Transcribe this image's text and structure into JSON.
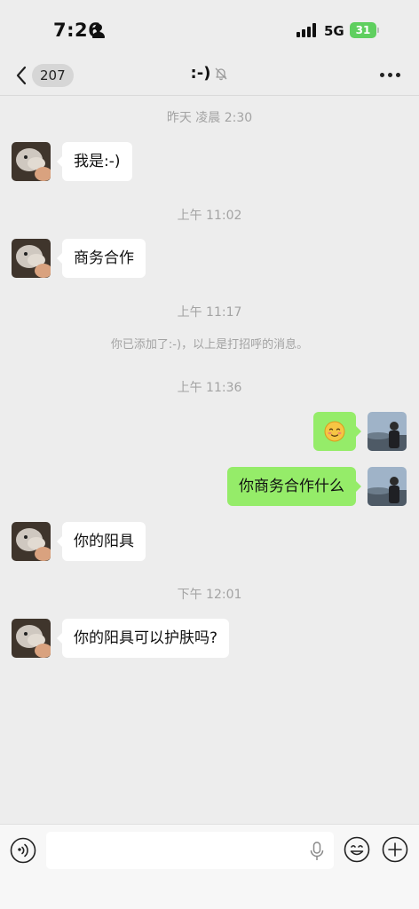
{
  "status_bar": {
    "time": "7:26",
    "network": "5G",
    "battery": "31"
  },
  "nav": {
    "back_count": "207",
    "title": ":-)"
  },
  "chat": {
    "messages": [
      {
        "type": "timestamp",
        "text": "昨天 凌晨 2:30"
      },
      {
        "type": "incoming",
        "text": "我是:-)"
      },
      {
        "type": "timestamp",
        "text": "上午 11:02"
      },
      {
        "type": "incoming",
        "text": "商务合作"
      },
      {
        "type": "timestamp",
        "text": "上午 11:17"
      },
      {
        "type": "system",
        "text": "你已添加了:-)，以上是打招呼的消息。"
      },
      {
        "type": "timestamp",
        "text": "上午 11:36"
      },
      {
        "type": "outgoing",
        "emoji": "blush-emoji"
      },
      {
        "type": "outgoing",
        "text": "你商务合作什么"
      },
      {
        "type": "incoming",
        "text": "你的阳具"
      },
      {
        "type": "timestamp",
        "text": "下午 12:01"
      },
      {
        "type": "incoming",
        "text": "你的阳具可以护肤吗?"
      }
    ]
  },
  "input_bar": {
    "placeholder": "",
    "value": ""
  },
  "colors": {
    "background": "#ededed",
    "outgoing_bubble": "#95ec69",
    "incoming_bubble": "#ffffff",
    "battery": "#5fcf5f"
  },
  "icons": [
    "back-chevron-icon",
    "mute-bell-icon",
    "more-dots-icon",
    "voice-icon",
    "mic-icon",
    "emoji-icon",
    "plus-icon"
  ]
}
